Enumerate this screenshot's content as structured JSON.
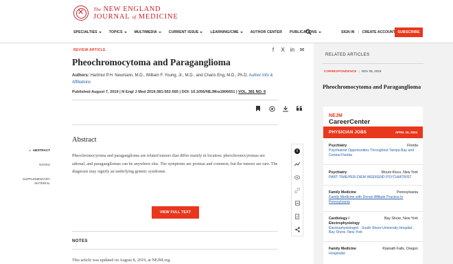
{
  "brand": {
    "line1_prefix": "The",
    "line1_main": "NEW ENGLAND",
    "line2_main": "JOURNAL",
    "line2_of": "of",
    "line2_end": "MEDICINE",
    "accent_color": "#e8371d",
    "logo_color": "#c8202c"
  },
  "nav": {
    "items": [
      {
        "label": "SPECIALTIES",
        "has_caret": true
      },
      {
        "label": "TOPICS",
        "has_caret": true
      },
      {
        "label": "MULTIMEDIA",
        "has_caret": true
      },
      {
        "label": "CURRENT ISSUE",
        "has_caret": true
      },
      {
        "label": "LEARNING/CME",
        "has_caret": true
      },
      {
        "label": "AUTHOR CENTER",
        "has_caret": false
      },
      {
        "label": "PUBLICATIONS",
        "has_caret": true
      }
    ],
    "search_icon": "search-icon",
    "signin": "SIGN IN",
    "create_account": "CREATE ACCOUNT",
    "subscribe": "SUBSCRIBE"
  },
  "article": {
    "type_label": "REVIEW ARTICLE",
    "share": [
      "f",
      "X",
      "in",
      "✉"
    ],
    "title": "Pheochromocytoma and Paraganglioma",
    "authors_label": "Authors:",
    "authors": "Hartmut P.H. Neumann, M.D., William F. Young, Jr., M.D., and Charis Eng, M.D., Ph.D.",
    "author_info_link": "Author Info & Affiliations",
    "published": "Published August 7, 2019",
    "citation": "N Engl J Med 2019;381:552-565",
    "doi": "DOI: 10.1056/NEJMra1806651",
    "volume": "VOL. 381 NO. 6",
    "separator": "|",
    "tools": [
      "bookmark-icon",
      "cite-icon",
      "download-icon",
      "quote-icon"
    ]
  },
  "left_nav": {
    "items": [
      {
        "label": "ABSTRACT",
        "active": true
      },
      {
        "label": "NOTES",
        "active": false
      },
      {
        "label": "SUPPLEMENTARY MATERIAL",
        "active": false
      }
    ]
  },
  "abstract": {
    "heading": "Abstract",
    "body": "Pheochromocytoma and paraganglioma are related tumors that differ mainly in location; pheochromocytomas are adrenal, and paragangliomas can be anywhere else. The symptoms are protean and common, but the tumors are rare. The diagnosis may signify an underlying genetic syndrome.",
    "view_full_text": "VIEW FULL TEXT"
  },
  "side_tools": [
    "info-icon",
    "metrics-icon",
    "view-icon",
    "link-icon",
    "figures-icon",
    "document-icon",
    "share-icon"
  ],
  "notes": {
    "heading": "NOTES",
    "text": "This article was updated on August 8, 2019, at NEJM.org."
  },
  "related": {
    "heading": "RELATED ARTICLES",
    "category": "CORRESPONDENCE",
    "date": "NOV 06, 2019",
    "title": "Pheochromocytoma and Paraganglioma"
  },
  "career_center": {
    "logo_top": "NEJM",
    "logo_bottom": "CareerCenter",
    "bar_label": "PHYSICIAN JOBS",
    "bar_date": "APRIL 16, 2024",
    "jobs": [
      {
        "specialty": "Psychiatry",
        "location": "Florida",
        "title": "Psychiatrist Opportunities Throughout Tampa Bay and Central Florida",
        "underline": false
      },
      {
        "specialty": "Psychiatry",
        "location": "Mount Kisco, New York",
        "title": "PART-TIME/PER-DIEM WEEKEND PSYCHIATRIST",
        "underline": false
      },
      {
        "specialty": "Family Medicine",
        "location": "Pennsylvania",
        "title": "Family Medicine with Drexel Affiliate Practice in Pennsylvania",
        "underline": true
      },
      {
        "specialty": "Cardiology / Electrophysiology",
        "location": "Bay Shore, New York",
        "title": "Electrophysiologist - South Shore University Hospital - Bay Shore, New York",
        "underline": false
      },
      {
        "specialty": "Family Medicine",
        "location": "Klamath Falls, Oregon",
        "title": "Hospitalist",
        "underline": false
      }
    ]
  }
}
